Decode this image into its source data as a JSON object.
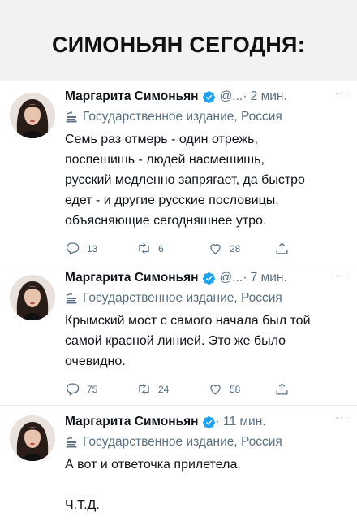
{
  "headline": "СИМОНЬЯН СЕГОДНЯ:",
  "more_glyph": "···",
  "tweets": [
    {
      "name": "Маргарита Симоньян",
      "handle": "@...",
      "time": " · 2 мин.",
      "label": "Государственное издание, Россия",
      "text": "Семь раз отмерь - один отрежь,\nпоспешишь - людей насмешишь,\nрусский медленно запрягает, да быстро\nедет - и другие русские пословицы,\nобъясняющие сегодняшнее утро.",
      "replies": "13",
      "retweets": "6",
      "likes": "28"
    },
    {
      "name": "Маргарита Симоньян",
      "handle": "@...",
      "time": " · 7 мин.",
      "label": "Государственное издание, Россия",
      "text": "Крымский мост с самого начала был той\nсамой красной линией. Это же было\nочевидно.",
      "replies": "75",
      "retweets": "24",
      "likes": "58"
    },
    {
      "name": "Маргарита Симоньян",
      "handle": "",
      "time": " · 11 мин.",
      "label": "Государственное издание, Россия",
      "text": "А вот и ответочка прилетела.\n\nЧ.Т.Д."
    }
  ],
  "colors": {
    "verified": "#1da1f2",
    "muted": "#5b7083",
    "divider": "#e6ecf0"
  },
  "icons": [
    "verified-badge-icon",
    "government-label-icon",
    "reply-icon",
    "retweet-icon",
    "like-icon",
    "share-icon",
    "more-icon"
  ]
}
